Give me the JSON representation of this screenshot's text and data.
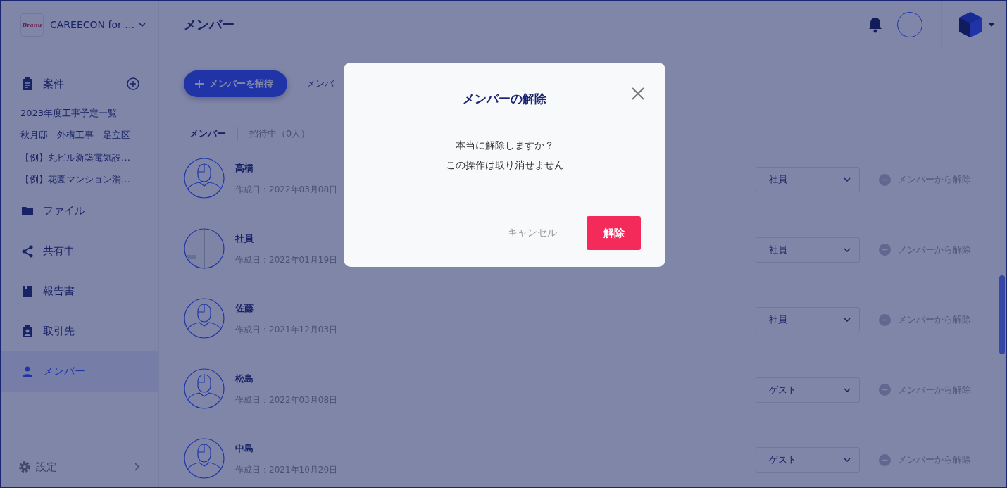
{
  "header": {
    "org_logo": "Branu",
    "org_name": "CAREECON for …",
    "page_title": "メンバー"
  },
  "sidebar": {
    "section_label": "案件",
    "projects": [
      "2023年度工事予定一覧",
      "秋月邸　外構工事　足立区",
      "【例】丸ビル新築電気設…",
      "【例】花園マンション消…"
    ],
    "nav": [
      {
        "label": "ファイル",
        "kind": "folder",
        "selected": false
      },
      {
        "label": "共有中",
        "kind": "share",
        "selected": false
      },
      {
        "label": "報告書",
        "kind": "book",
        "selected": false
      },
      {
        "label": "取引先",
        "kind": "contact",
        "selected": false
      },
      {
        "label": "メンバー",
        "kind": "person",
        "selected": true
      }
    ],
    "settings": "設定"
  },
  "toolbar": {
    "invite_button": "メンバーを招待",
    "link": "メンバ"
  },
  "tabs": [
    {
      "label": "メンバー",
      "selected": true
    },
    {
      "label": "招待中（0人）",
      "selected": false
    }
  ],
  "members": [
    {
      "name": "高橋",
      "created": "作成日：2022年03月08日",
      "role": "社員",
      "remove": "メンバーから解除",
      "kind": "outline"
    },
    {
      "name": "社員",
      "created": "作成日：2022年01月19日",
      "role": "社員",
      "remove": "メンバーから解除",
      "kind": "photo"
    },
    {
      "name": "佐藤",
      "created": "作成日：2021年12月03日",
      "role": "社員",
      "remove": "メンバーから解除",
      "kind": "outline"
    },
    {
      "name": "松島",
      "created": "作成日：2022年03月08日",
      "role": "ゲスト",
      "remove": "メンバーから解除",
      "kind": "outline"
    },
    {
      "name": "中島",
      "created": "作成日：2021年10月20日",
      "role": "ゲスト",
      "remove": "メンバーから解除",
      "kind": "outline"
    }
  ],
  "dialog": {
    "title": "メンバーの解除",
    "message_lines": [
      "本当に解除しますか？",
      "この操作は取り消せません"
    ],
    "cancel": "キャンセル",
    "confirm": "解除"
  }
}
